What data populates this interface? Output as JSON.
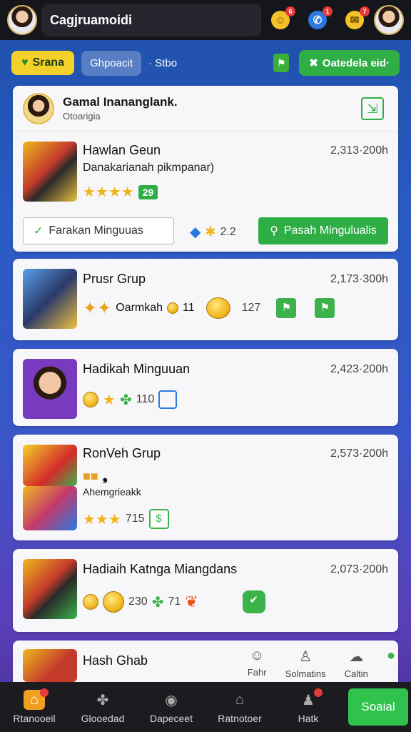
{
  "topbar": {
    "title": "Cagjruamoidi",
    "icons": [
      "coin-icon",
      "chat-icon",
      "gift-icon"
    ],
    "badges": [
      "6",
      "1",
      "7"
    ]
  },
  "tabs": {
    "active": "Srana",
    "second": "Ghpoacit",
    "third": "· Stbo",
    "action": "Oatedela eid·"
  },
  "header": {
    "title": "Gamal Inananglank.",
    "subtitle": "Otoarigia"
  },
  "games": [
    {
      "title": "Hawlan Geun",
      "time": "2,313·200h",
      "line2": "Danakarianah pikmpanar)",
      "rating_badge": "29",
      "outline_btn": "Farakan Minguuas",
      "mid_text": "2.2",
      "solid_btn": "Pasah Mingulualis"
    },
    {
      "title": "Prusr Grup",
      "time": "2,173·300h",
      "line2": "Oarmkah",
      "coin_count": "11",
      "count": "127"
    },
    {
      "title": "Hadikah Minguuan",
      "time": "2,423·200h",
      "count": "110"
    },
    {
      "title": "RonVeh Grup",
      "time": "2,573·200h",
      "line2": "Ahemgrieakk",
      "count": "715"
    },
    {
      "title": "Hadiaih Katnga Miangdans",
      "time": "2,073·200h",
      "count1": "230",
      "count2": "71"
    },
    {
      "title": "Hash Ghab"
    }
  ],
  "sub_nav": [
    "Fahr",
    "Solmatins",
    "Caltin"
  ],
  "bottom_nav": [
    "Rtanooeil",
    "Glooedad",
    "Dapeceet",
    "Ratnotoer",
    "Hatk"
  ],
  "bottom_cta": "Soaial",
  "colors": {
    "accent_green": "#2fae46",
    "yellow": "#f3d12a",
    "topbar": "#15161c"
  }
}
